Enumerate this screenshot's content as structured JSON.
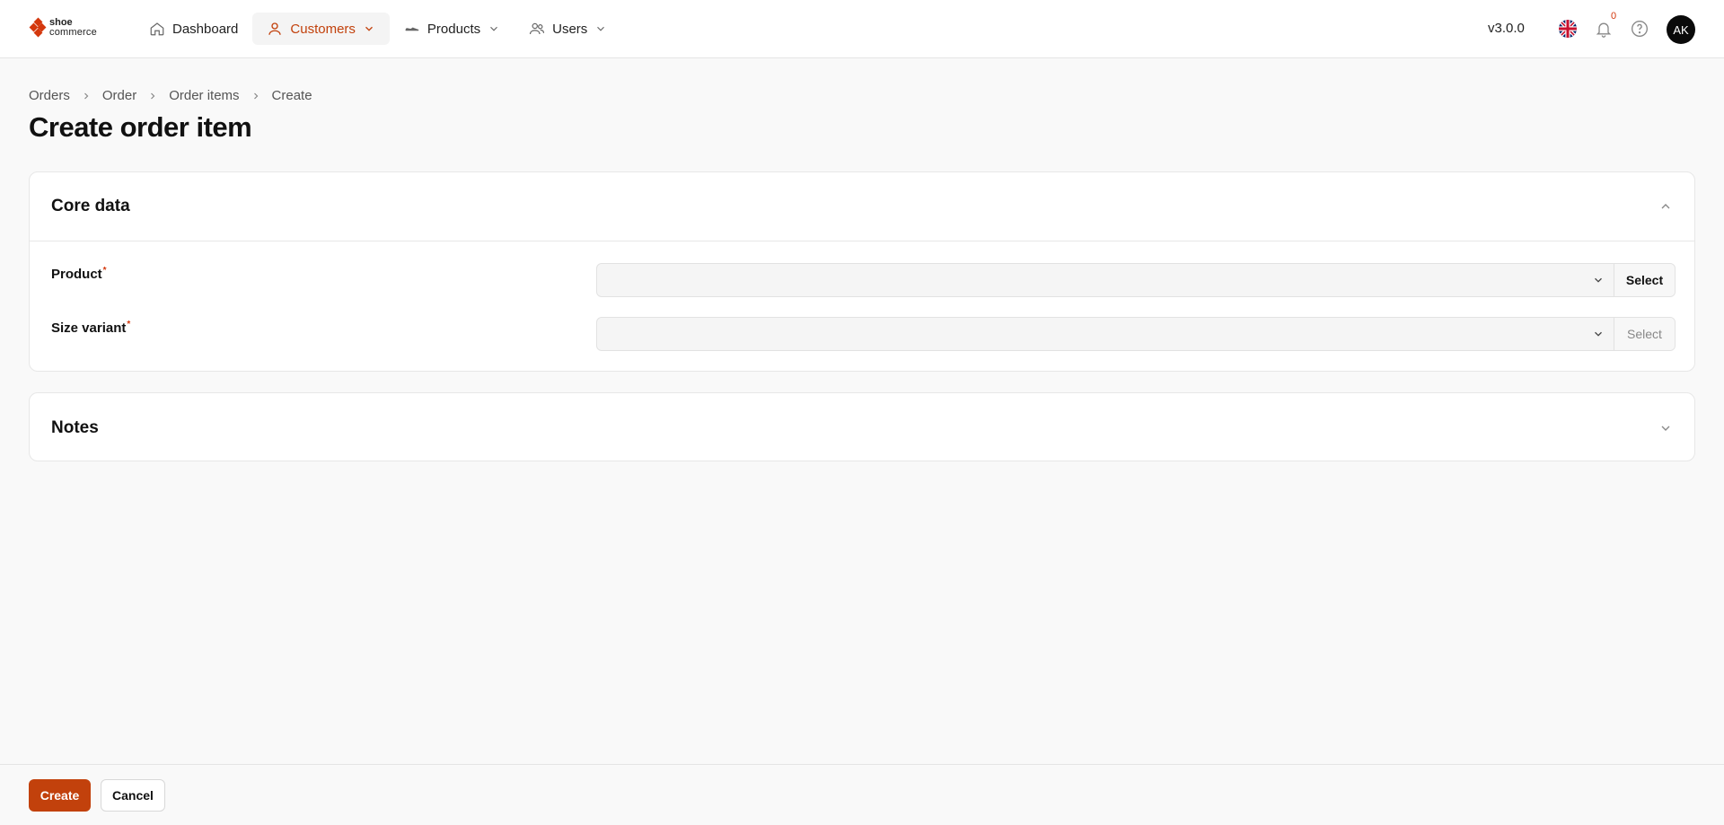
{
  "brand": {
    "line1": "shoe",
    "line2": "commerce",
    "accent_color": "#c2410c"
  },
  "nav": {
    "items": [
      {
        "label": "Dashboard",
        "icon": "home-icon"
      },
      {
        "label": "Customers",
        "icon": "user-icon",
        "active": true
      },
      {
        "label": "Products",
        "icon": "shoe-icon"
      },
      {
        "label": "Users",
        "icon": "users-icon"
      }
    ]
  },
  "header": {
    "version": "v3.0.0",
    "notification_count": "0",
    "avatar_initials": "AK"
  },
  "breadcrumb": [
    "Orders",
    "Order",
    "Order items",
    "Create"
  ],
  "page": {
    "title": "Create order item"
  },
  "core_card": {
    "title": "Core data",
    "fields": [
      {
        "label": "Product",
        "required_mark": "*",
        "value": "",
        "button": "Select"
      },
      {
        "label": "Size variant",
        "required_mark": "*",
        "value": "",
        "button": "Select"
      }
    ]
  },
  "notes_card": {
    "title": "Notes"
  },
  "footer": {
    "create_label": "Create",
    "cancel_label": "Cancel"
  }
}
